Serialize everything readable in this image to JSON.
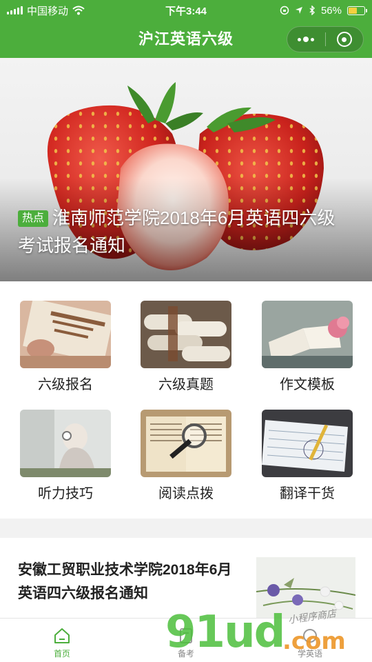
{
  "status_bar": {
    "carrier": "中国移动",
    "time": "下午3:44",
    "battery_percent": "56%",
    "battery_level": 0.56
  },
  "nav": {
    "title": "沪江英语六级",
    "more_icon": "more-dots-icon",
    "close_icon": "target-close-icon"
  },
  "banner": {
    "badge": "热点",
    "title": "淮南师范学院2018年6月英语四六级考试报名通知"
  },
  "grid": {
    "items": [
      {
        "label": "六级报名",
        "icon": "book-image"
      },
      {
        "label": "六级真题",
        "icon": "scrolls-image"
      },
      {
        "label": "作文模板",
        "icon": "open-book-flower-image"
      },
      {
        "label": "听力技巧",
        "icon": "headphones-girl-image"
      },
      {
        "label": "阅读点拨",
        "icon": "magnifier-image"
      },
      {
        "label": "翻译干货",
        "icon": "notebook-pen-image"
      }
    ]
  },
  "article": {
    "title": "安徽工贸职业技术学院2018年6月英语四六级报名通知"
  },
  "tabbar": {
    "tabs": [
      {
        "label": "首页",
        "icon": "home-icon",
        "active": true
      },
      {
        "label": "备考",
        "icon": "study-icon",
        "active": false
      },
      {
        "label": "学英语",
        "icon": "learn-icon",
        "active": false
      }
    ]
  },
  "watermark": {
    "main": "91ud",
    "com": ".com",
    "sub": "小程序商店"
  },
  "colors": {
    "brand_green": "#4cae3c",
    "battery_yellow": "#f4d03f"
  }
}
